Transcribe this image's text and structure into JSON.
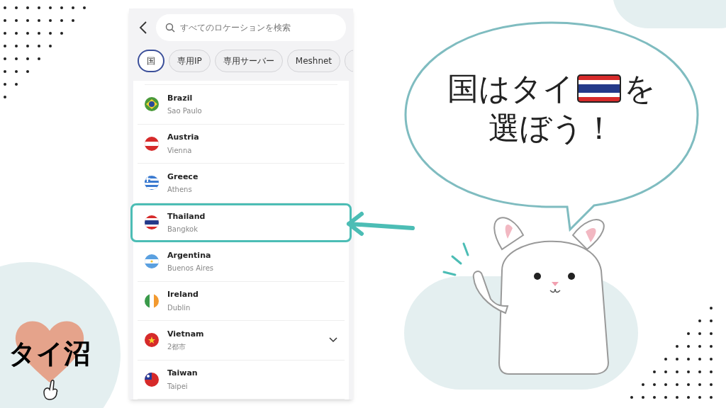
{
  "search": {
    "placeholder": "すべてのロケーションを検索"
  },
  "filters": [
    {
      "label": "国",
      "selected": true
    },
    {
      "label": "専用IP",
      "selected": false
    },
    {
      "label": "専用サーバー",
      "selected": false
    },
    {
      "label": "Meshnet",
      "selected": false
    },
    {
      "selected": false
    }
  ],
  "locations": [
    {
      "country": "Brazil",
      "city": "Sao Paulo",
      "kind": "br",
      "selected": false,
      "expandable": false
    },
    {
      "country": "Austria",
      "city": "Vienna",
      "kind": "at",
      "selected": false,
      "expandable": false
    },
    {
      "country": "Greece",
      "city": "Athens",
      "kind": "gr",
      "selected": false,
      "expandable": false
    },
    {
      "country": "Thailand",
      "city": "Bangkok",
      "kind": "th",
      "selected": true,
      "expandable": false
    },
    {
      "country": "Argentina",
      "city": "Buenos Aires",
      "kind": "ar",
      "selected": false,
      "expandable": false
    },
    {
      "country": "Ireland",
      "city": "Dublin",
      "kind": "ie",
      "selected": false,
      "expandable": false
    },
    {
      "country": "Vietnam",
      "city": "2都市",
      "kind": "vn",
      "selected": false,
      "expandable": true
    },
    {
      "country": "Taiwan",
      "city": "Taipei",
      "kind": "tw",
      "selected": false,
      "expandable": false
    }
  ],
  "speech_bubble": {
    "line_1_before": "国はタイ",
    "line_1_after": "を",
    "line_2": "選ぼう！"
  },
  "logo": {
    "text": "タイ沼"
  }
}
